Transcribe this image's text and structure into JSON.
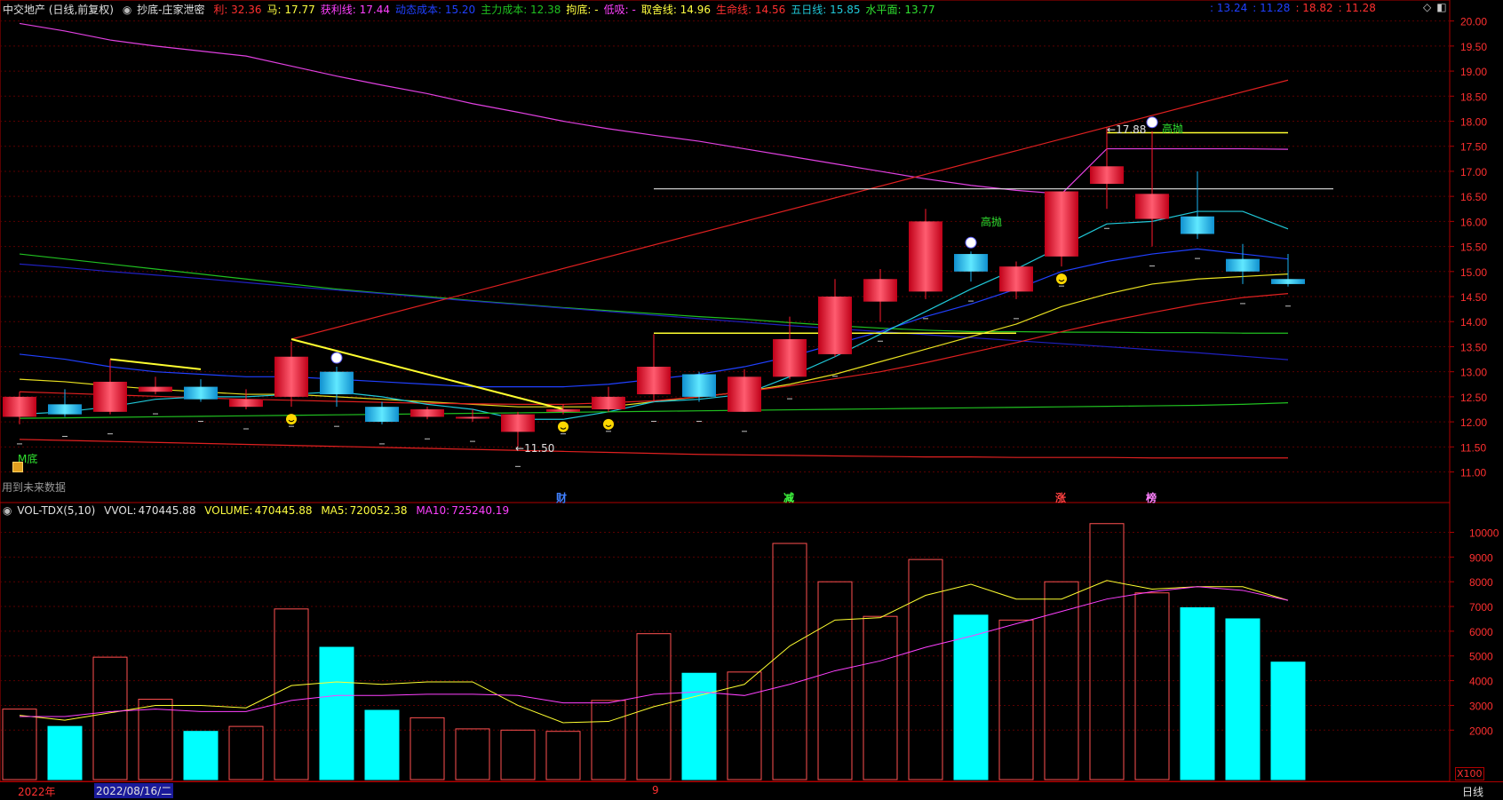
{
  "header": {
    "title": "中交地产 (日线,前复权)",
    "indicator_name": "抄底-庄家泄密",
    "items": [
      {
        "label": "利:",
        "value": "32.36",
        "color": "#ff3030"
      },
      {
        "label": "马:",
        "value": "17.77",
        "color": "#ffff40"
      },
      {
        "label": "获利线:",
        "value": "17.44",
        "color": "#ff40ff"
      },
      {
        "label": "动态成本:",
        "value": "15.20",
        "color": "#2040ff"
      },
      {
        "label": "主力成本:",
        "value": "12.38",
        "color": "#20c020"
      },
      {
        "label": "拘底:",
        "value": "-",
        "color": "#ffff40"
      },
      {
        "label": "低吸:",
        "value": "-",
        "color": "#ff40ff"
      },
      {
        "label": "取舍线:",
        "value": "14.96",
        "color": "#ffff40"
      },
      {
        "label": "生命线:",
        "value": "14.56",
        "color": "#ff3030"
      },
      {
        "label": "五日线:",
        "value": "15.85",
        "color": "#20c8d8"
      },
      {
        "label": "水平面:",
        "value": "13.77",
        "color": "#30e030"
      }
    ],
    "right_values": [
      {
        "text": ": 13.24",
        "color": "#2040ff"
      },
      {
        "text": ": 11.28",
        "color": "#2040ff"
      },
      {
        "text": ": 18.82",
        "color": "#ff3030"
      },
      {
        "text": ": 11.28",
        "color": "#ff3030"
      }
    ]
  },
  "vol_header": {
    "name": "VOL-TDX(5,10)",
    "vvol_label": "VVOL:",
    "vvol_value": "470445.88",
    "volume_label": "VOLUME:",
    "volume_value": "470445.88",
    "ma5_label": "MA5:",
    "ma5_value": "720052.38",
    "ma10_label": "MA10:",
    "ma10_value": "725240.19"
  },
  "annotations": {
    "future_data_note": "用到未来数据",
    "m_bottom": "M底",
    "low_marker": "11.50",
    "high_marker": "17.88",
    "sell_signal_1": "高抛",
    "sell_signal_2": "高抛",
    "event_cai": "财",
    "event_jian": "减",
    "event_zhang": "涨",
    "event_bang": "榜"
  },
  "footer": {
    "year": "2022年",
    "cursor_date": "2022/08/16/二",
    "month_marker": "9",
    "period_button": "日线",
    "vol_unit": "X100"
  },
  "colors": {
    "up": "#ff1a2e",
    "down": "#1ab2f0",
    "vol_down": "#00ffff",
    "vol_up_border": "#ff5050",
    "grid": "#5a0000",
    "axis": "#b00000",
    "axis_text": "#ff3030"
  },
  "chart_data": [
    {
      "type": "candlestick",
      "title": "中交地产 (日线,前复权)",
      "y_ticks": [
        11.0,
        11.5,
        12.0,
        12.5,
        13.0,
        13.5,
        14.0,
        14.5,
        15.0,
        15.5,
        16.0,
        16.5,
        17.0,
        17.5,
        18.0,
        18.5,
        19.0,
        19.5,
        20.0
      ],
      "ylim": [
        10.85,
        20.1
      ],
      "candles": [
        {
          "o": 12.1,
          "c": 12.5,
          "h": 12.6,
          "l": 11.95
        },
        {
          "o": 12.35,
          "c": 12.15,
          "h": 12.65,
          "l": 12.1
        },
        {
          "o": 12.2,
          "c": 12.8,
          "h": 13.25,
          "l": 12.15
        },
        {
          "o": 12.6,
          "c": 12.7,
          "h": 12.9,
          "l": 12.55
        },
        {
          "o": 12.7,
          "c": 12.45,
          "h": 12.85,
          "l": 12.4
        },
        {
          "o": 12.3,
          "c": 12.45,
          "h": 12.65,
          "l": 12.25
        },
        {
          "o": 12.5,
          "c": 13.3,
          "h": 13.6,
          "l": 12.3
        },
        {
          "o": 13.0,
          "c": 12.55,
          "h": 13.1,
          "l": 12.3
        },
        {
          "o": 12.3,
          "c": 12.0,
          "h": 12.4,
          "l": 11.95
        },
        {
          "o": 12.1,
          "c": 12.25,
          "h": 12.3,
          "l": 12.05
        },
        {
          "o": 12.1,
          "c": 12.1,
          "h": 12.25,
          "l": 12.0
        },
        {
          "o": 11.8,
          "c": 12.15,
          "h": 12.2,
          "l": 11.5
        },
        {
          "o": 12.2,
          "c": 12.25,
          "h": 12.35,
          "l": 12.15
        },
        {
          "o": 12.25,
          "c": 12.5,
          "h": 12.7,
          "l": 12.2
        },
        {
          "o": 12.55,
          "c": 13.1,
          "h": 13.75,
          "l": 12.4
        },
        {
          "o": 12.95,
          "c": 12.5,
          "h": 13.0,
          "l": 12.4
        },
        {
          "o": 12.2,
          "c": 12.9,
          "h": 13.05,
          "l": 12.2
        },
        {
          "o": 12.9,
          "c": 13.65,
          "h": 14.1,
          "l": 12.85
        },
        {
          "o": 13.35,
          "c": 14.5,
          "h": 14.85,
          "l": 13.3
        },
        {
          "o": 14.4,
          "c": 14.85,
          "h": 15.05,
          "l": 14.0
        },
        {
          "o": 14.6,
          "c": 16.0,
          "h": 16.25,
          "l": 14.45
        },
        {
          "o": 15.35,
          "c": 15.0,
          "h": 15.4,
          "l": 14.8
        },
        {
          "o": 14.6,
          "c": 15.1,
          "h": 15.2,
          "l": 14.45
        },
        {
          "o": 15.3,
          "c": 16.6,
          "h": 16.6,
          "l": 15.1
        },
        {
          "o": 16.75,
          "c": 17.1,
          "h": 17.88,
          "l": 16.25
        },
        {
          "o": 16.05,
          "c": 16.55,
          "h": 17.8,
          "l": 15.5
        },
        {
          "o": 16.1,
          "c": 15.75,
          "h": 17.0,
          "l": 15.65
        },
        {
          "o": 15.25,
          "c": 15.0,
          "h": 15.55,
          "l": 14.75
        },
        {
          "o": 14.85,
          "c": 14.75,
          "h": 15.35,
          "l": 14.7
        }
      ],
      "ma5": [
        12.15,
        12.2,
        12.3,
        12.45,
        12.5,
        12.5,
        12.55,
        12.6,
        12.5,
        12.35,
        12.25,
        12.05,
        12.05,
        12.2,
        12.4,
        12.45,
        12.55,
        12.9,
        13.3,
        13.75,
        14.2,
        14.65,
        15.05,
        15.5,
        15.95,
        16.0,
        16.2,
        16.2,
        15.85
      ],
      "ma_blue": [
        13.35,
        13.25,
        13.1,
        13.0,
        12.95,
        12.9,
        12.9,
        12.85,
        12.8,
        12.75,
        12.7,
        12.7,
        12.7,
        12.75,
        12.85,
        12.95,
        13.1,
        13.3,
        13.55,
        13.8,
        14.1,
        14.35,
        14.65,
        15.0,
        15.2,
        15.35,
        15.45,
        15.35,
        15.25
      ],
      "ma_yellow": [
        12.85,
        12.8,
        12.72,
        12.65,
        12.6,
        12.55,
        12.55,
        12.5,
        12.45,
        12.4,
        12.35,
        12.3,
        12.3,
        12.3,
        12.4,
        12.5,
        12.6,
        12.75,
        12.95,
        13.2,
        13.45,
        13.7,
        13.95,
        14.3,
        14.55,
        14.75,
        14.85,
        14.9,
        14.95
      ],
      "ma_red": [
        12.6,
        12.57,
        12.54,
        12.51,
        12.48,
        12.45,
        12.43,
        12.41,
        12.39,
        12.37,
        12.36,
        12.35,
        12.35,
        12.38,
        12.42,
        12.5,
        12.6,
        12.72,
        12.86,
        13.0,
        13.18,
        13.38,
        13.58,
        13.8,
        14.0,
        14.18,
        14.35,
        14.48,
        14.56
      ],
      "ma_magenta_top": [
        19.95,
        19.8,
        19.62,
        19.5,
        19.4,
        19.3,
        19.1,
        18.9,
        18.72,
        18.55,
        18.35,
        18.18,
        18.0,
        17.85,
        17.72,
        17.6,
        17.45,
        17.3,
        17.15,
        17.0,
        16.85,
        16.72,
        16.62,
        16.55,
        17.45,
        17.45,
        17.45,
        17.45,
        17.44
      ],
      "ma_green_long": [
        15.35,
        15.25,
        15.15,
        15.05,
        14.95,
        14.85,
        14.75,
        14.65,
        14.57,
        14.5,
        14.42,
        14.35,
        14.28,
        14.22,
        14.16,
        14.1,
        14.05,
        13.98,
        13.92,
        13.87,
        13.83,
        13.8,
        13.8,
        13.79,
        13.79,
        13.78,
        13.78,
        13.77,
        13.77
      ],
      "ma_navy_long": [
        15.15,
        15.08,
        15.0,
        14.93,
        14.86,
        14.78,
        14.7,
        14.63,
        14.56,
        14.48,
        14.41,
        14.34,
        14.27,
        14.2,
        14.13,
        14.06,
        13.99,
        13.92,
        13.86,
        13.8,
        13.74,
        13.68,
        13.62,
        13.56,
        13.5,
        13.44,
        13.38,
        13.31,
        13.24
      ],
      "support_green": [
        12.07,
        12.08,
        12.09,
        12.1,
        12.11,
        12.12,
        12.13,
        12.14,
        12.15,
        12.16,
        12.17,
        12.18,
        12.19,
        12.2,
        12.21,
        12.22,
        12.23,
        12.24,
        12.25,
        12.26,
        12.27,
        12.28,
        12.29,
        12.3,
        12.31,
        12.32,
        12.33,
        12.35,
        12.38
      ],
      "support_red": [
        11.65,
        11.63,
        11.61,
        11.59,
        11.57,
        11.55,
        11.53,
        11.51,
        11.49,
        11.47,
        11.45,
        11.43,
        11.41,
        11.39,
        11.37,
        11.35,
        11.34,
        11.33,
        11.32,
        11.31,
        11.3,
        11.3,
        11.29,
        11.29,
        11.29,
        11.28,
        11.28,
        11.28,
        11.28
      ],
      "trend_red": {
        "x0": 6,
        "y0": 13.65,
        "x1": 28,
        "y1": 18.82
      },
      "trend_yellow_1": {
        "x0": 2,
        "y0": 13.25,
        "x1": 4,
        "y1": 13.05
      },
      "trend_yellow_2": {
        "x0": 6,
        "y0": 13.65,
        "x1": 12,
        "y1": 12.25
      },
      "hline_yellow": {
        "x0": 14,
        "x1": 22,
        "y": 13.77
      },
      "hline_white": {
        "x0": 14,
        "x1": 29,
        "y": 16.65
      },
      "hline_yellow_top": {
        "x0": 24,
        "x1": 28,
        "y": 17.77
      }
    },
    {
      "type": "bar",
      "title": "VOL-TDX(5,10)",
      "unit": "X100",
      "y_ticks": [
        2000,
        3000,
        4000,
        5000,
        6000,
        7000,
        8000,
        9000,
        10000
      ],
      "ylim": [
        0,
        10700
      ],
      "values": [
        2850,
        2150,
        4950,
        3250,
        1950,
        2150,
        6900,
        5350,
        2800,
        2500,
        2050,
        2000,
        1950,
        3200,
        5900,
        4300,
        4350,
        9550,
        8000,
        6600,
        8900,
        6650,
        6450,
        8000,
        10350,
        7550,
        6950,
        6500,
        4750
      ],
      "ma5": [
        2600,
        2400,
        2700,
        3000,
        3000,
        2900,
        3800,
        3950,
        3850,
        3950,
        3950,
        3000,
        2300,
        2350,
        2950,
        3400,
        3850,
        5400,
        6450,
        6550,
        7450,
        7900,
        7300,
        7300,
        8050,
        7700,
        7800,
        7800,
        7250
      ],
      "ma10": [
        2550,
        2550,
        2750,
        2850,
        2750,
        2750,
        3200,
        3400,
        3400,
        3450,
        3450,
        3400,
        3100,
        3100,
        3450,
        3550,
        3400,
        3850,
        4400,
        4800,
        5350,
        5800,
        6300,
        6800,
        7300,
        7600,
        7800,
        7650,
        7250
      ]
    }
  ]
}
